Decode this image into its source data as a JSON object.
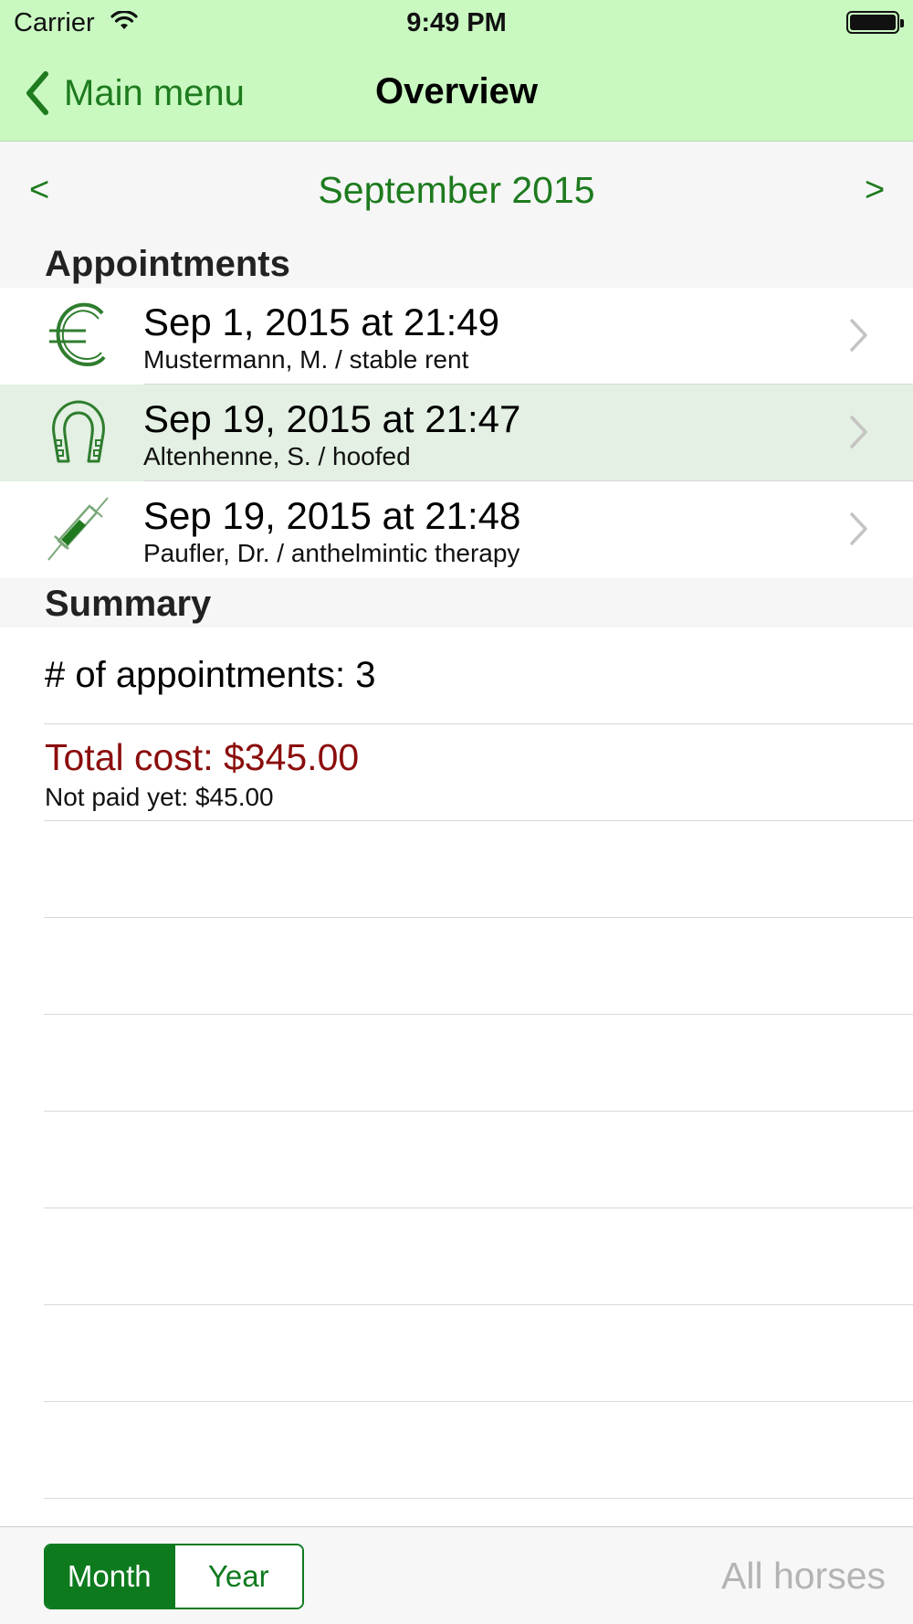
{
  "status_bar": {
    "carrier": "Carrier",
    "time": "9:49 PM"
  },
  "nav": {
    "back_label": "Main menu",
    "title": "Overview"
  },
  "month_bar": {
    "prev": "<",
    "label": "September 2015",
    "next": ">"
  },
  "appointments": {
    "header": "Appointments",
    "items": [
      {
        "icon": "euro-icon",
        "title": "Sep 1, 2015 at 21:49",
        "subtitle": "Mustermann, M. / stable rent",
        "selected": false
      },
      {
        "icon": "horseshoe-icon",
        "title": "Sep 19, 2015 at 21:47",
        "subtitle": "Altenhenne, S. / hoofed",
        "selected": true
      },
      {
        "icon": "syringe-icon",
        "title": "Sep 19, 2015 at 21:48",
        "subtitle": "Paufler, Dr. / anthelmintic therapy",
        "selected": false
      }
    ]
  },
  "summary": {
    "header": "Summary",
    "count_text": "# of appointments: 3",
    "total_text": "Total cost: $345.00",
    "unpaid_text": "Not paid yet: $45.00"
  },
  "toolbar": {
    "segments": [
      "Month",
      "Year"
    ],
    "selected_segment": "Month",
    "filter_label": "All horses"
  },
  "colors": {
    "nav_background": "#c9f9c1",
    "accent_green": "#1e7b1e",
    "segment_green": "#0e7a1e",
    "total_cost_red": "#8b0d0d",
    "selected_row": "#e3f0e3"
  }
}
